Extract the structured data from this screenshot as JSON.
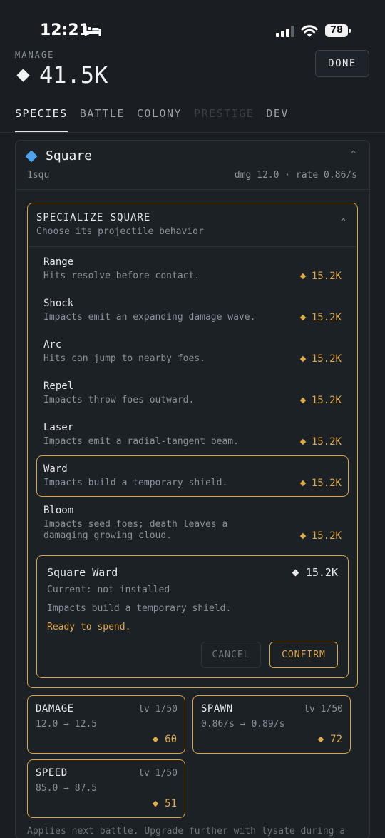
{
  "status_bar": {
    "time": "12:21",
    "battery": "78"
  },
  "header": {
    "label": "MANAGE",
    "balance": "41.5K",
    "done_label": "DONE"
  },
  "tabs": [
    {
      "label": "SPECIES",
      "state": "active"
    },
    {
      "label": "BATTLE",
      "state": "normal"
    },
    {
      "label": "COLONY",
      "state": "normal"
    },
    {
      "label": "PRESTIGE",
      "state": "disabled"
    },
    {
      "label": "DEV",
      "state": "normal"
    }
  ],
  "species": {
    "name": "Square",
    "id": "1squ",
    "stats": "dmg 12.0 · rate 0.86/s",
    "gem_color": "#4da3f0"
  },
  "specialize": {
    "title": "SPECIALIZE SQUARE",
    "subtitle": "Choose its projectile behavior",
    "options": [
      {
        "name": "Range",
        "desc": "Hits resolve before contact.",
        "cost": "15.2K"
      },
      {
        "name": "Shock",
        "desc": "Impacts emit an expanding damage wave.",
        "cost": "15.2K"
      },
      {
        "name": "Arc",
        "desc": "Hits can jump to nearby foes.",
        "cost": "15.2K"
      },
      {
        "name": "Repel",
        "desc": "Impacts throw foes outward.",
        "cost": "15.2K"
      },
      {
        "name": "Laser",
        "desc": "Impacts emit a radial-tangent beam.",
        "cost": "15.2K"
      },
      {
        "name": "Ward",
        "desc": "Impacts build a temporary shield.",
        "cost": "15.2K"
      },
      {
        "name": "Bloom",
        "desc": "Impacts seed foes; death leaves a damaging growing cloud.",
        "cost": "15.2K"
      }
    ],
    "detail": {
      "title": "Square Ward",
      "cost": "15.2K",
      "current": "Current: not installed",
      "desc": "Impacts build a temporary shield.",
      "ready": "Ready to spend.",
      "cancel_label": "CANCEL",
      "confirm_label": "CONFIRM"
    }
  },
  "upgrades": [
    {
      "name": "DAMAGE",
      "level": "lv 1/50",
      "value": "12.0 → 12.5",
      "cost": "60"
    },
    {
      "name": "SPAWN",
      "level": "lv 1/50",
      "value": "0.86/s → 0.89/s",
      "cost": "72"
    },
    {
      "name": "SPEED",
      "level": "lv 1/50",
      "value": "85.0 → 87.5",
      "cost": "51"
    }
  ],
  "footnote": "Applies next battle. Upgrade further with lysate during a",
  "colors": {
    "accent": "#d9a441",
    "background": "#1a1e23",
    "panel": "#1c2126"
  }
}
